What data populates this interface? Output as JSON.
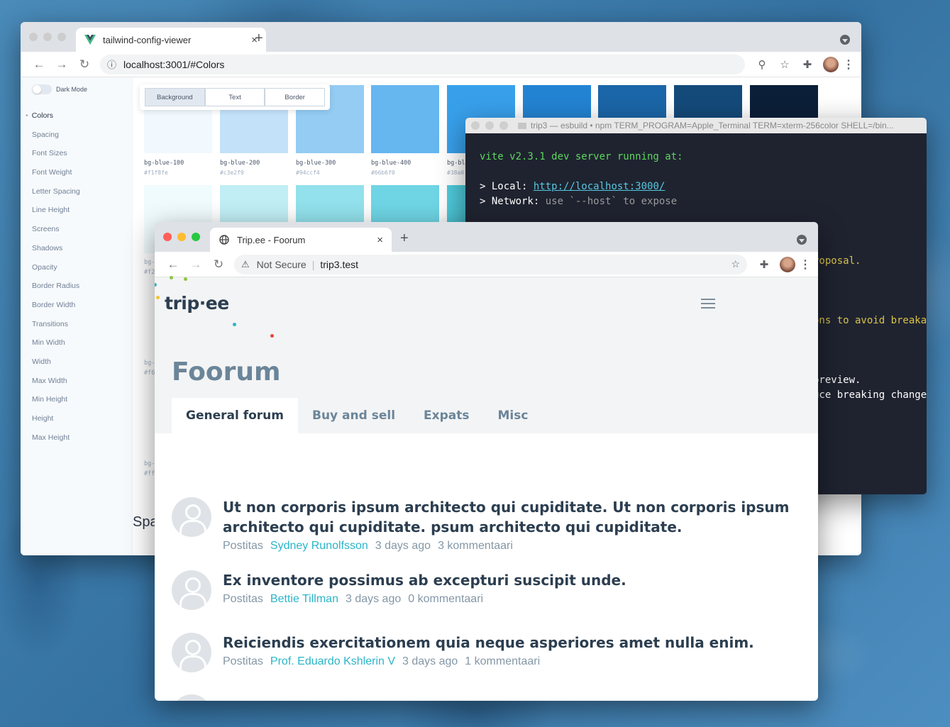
{
  "back_window": {
    "tab_title": "tailwind-config-viewer",
    "url": "localhost:3001/#Colors",
    "dark_mode_label": "Dark Mode",
    "nav_items": [
      "Colors",
      "Spacing",
      "Font Sizes",
      "Font Weight",
      "Letter Spacing",
      "Line Height",
      "Screens",
      "Shadows",
      "Opacity",
      "Border Radius",
      "Border Width",
      "Transitions",
      "Min Width",
      "Width",
      "Max Width",
      "Min Height",
      "Height",
      "Max Height"
    ],
    "active_nav": "Colors",
    "segment_tabs": [
      "Background",
      "Text",
      "Border"
    ],
    "active_segment": "Background",
    "swatches_row1": [
      {
        "name": "bg-blue-100",
        "hex": "#f1f8fe",
        "color": "#f1f8fe"
      },
      {
        "name": "bg-blue-200",
        "hex": "#c3e2f9",
        "color": "#c3e2f9"
      },
      {
        "name": "bg-blue-300",
        "hex": "#94ccf4",
        "color": "#94ccf4"
      },
      {
        "name": "bg-blue-400",
        "hex": "#66b6f0",
        "color": "#66b6f0"
      },
      {
        "name": "bg-bl",
        "hex": "#38a0",
        "color": "#38a0eb"
      },
      {
        "name": "",
        "hex": "",
        "color": "#2383d3"
      },
      {
        "name": "",
        "hex": "",
        "color": "#1b66a8"
      },
      {
        "name": "",
        "hex": "",
        "color": "#144a7a"
      },
      {
        "name": "",
        "hex": "",
        "color": "#0b1f38"
      }
    ],
    "swatches_row2_colors": [
      "#f0fbfd",
      "#c1eef5",
      "#92e1ec",
      "#6fd5e4",
      "#4fcbdc"
    ],
    "fragments": [
      "bg-",
      "#f2",
      "bg-",
      "#f6",
      "bg-",
      "#fff"
    ],
    "section_heading_fragment": "Spa"
  },
  "terminal": {
    "title": "trip3 — esbuild • npm TERM_PROGRAM=Apple_Terminal TERM=xterm-256color SHELL=/bin...",
    "line1": "vite v2.3.1 dev server running at:",
    "local_label": "> Local:",
    "local_url": "http://localhost:3000/",
    "network_label": "> Network:",
    "network_text": "use `--host` to expose",
    "frag1": "roposal.",
    "frag2": "ons to avoid breaka",
    "frag3": "preview.",
    "frag4": "uce breaking change"
  },
  "front_window": {
    "tab_title": "Trip.ee - Foorum",
    "security_label": "Not Secure",
    "url": "trip3.test",
    "logo_text": "trip·ee",
    "page_title": "Foorum",
    "tabs": [
      "General forum",
      "Buy and sell",
      "Expats",
      "Misc"
    ],
    "active_tab": "General forum",
    "posts": [
      {
        "title": "Ut non corporis ipsum architecto qui cupiditate. Ut non corporis ipsum architecto qui cupiditate. psum architecto qui cupiditate.",
        "prefix": "Postitas",
        "author": "Sydney Runolfsson",
        "time": "3 days ago",
        "comments": "3 kommentaari"
      },
      {
        "title": "Ex inventore possimus ab excepturi suscipit unde.",
        "prefix": "Postitas",
        "author": "Bettie Tillman",
        "time": "3 days ago",
        "comments": "0 kommentaari"
      },
      {
        "title": "Reiciendis exercitationem quia neque asperiores amet nulla enim.",
        "prefix": "Postitas",
        "author": "Prof. Eduardo Kshlerin V",
        "time": "3 days ago",
        "comments": "1 kommentaari"
      }
    ]
  },
  "colors": {
    "accent": "#2bb5c8",
    "heading": "#2c3e50",
    "muted": "#6b8599",
    "terminal_bg": "#1f2330"
  }
}
